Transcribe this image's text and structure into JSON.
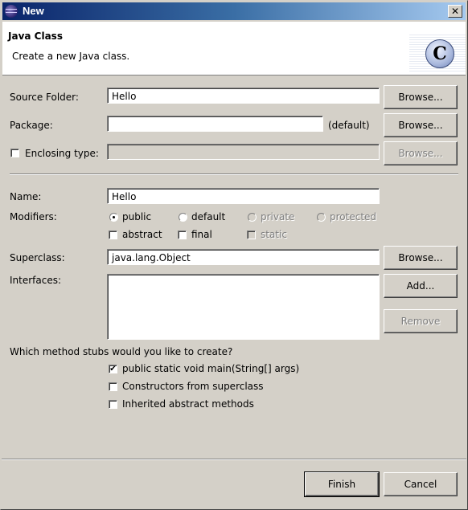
{
  "window": {
    "title": "New",
    "close_glyph": "✕"
  },
  "banner": {
    "title": "Java Class",
    "description": "Create a new Java class.",
    "icon_letter": "C"
  },
  "form": {
    "source_folder": {
      "label": "Source Folder:",
      "value": "Hello",
      "browse_label": "Browse..."
    },
    "package": {
      "label": "Package:",
      "value": "",
      "hint": "(default)",
      "browse_label": "Browse..."
    },
    "enclosing_type": {
      "label": "Enclosing type:",
      "checked": false,
      "value": "",
      "browse_label": "Browse..."
    },
    "name": {
      "label": "Name:",
      "value": "Hello"
    },
    "modifiers": {
      "label": "Modifiers:",
      "access": [
        {
          "label": "public",
          "selected": true,
          "enabled": true
        },
        {
          "label": "default",
          "selected": false,
          "enabled": true
        },
        {
          "label": "private",
          "selected": false,
          "enabled": false
        },
        {
          "label": "protected",
          "selected": false,
          "enabled": false
        }
      ],
      "flags": [
        {
          "label": "abstract",
          "checked": false,
          "enabled": true
        },
        {
          "label": "final",
          "checked": false,
          "enabled": true
        },
        {
          "label": "static",
          "checked": false,
          "enabled": false
        }
      ]
    },
    "superclass": {
      "label": "Superclass:",
      "value": "java.lang.Object",
      "browse_label": "Browse..."
    },
    "interfaces": {
      "label": "Interfaces:",
      "items": [],
      "add_label": "Add...",
      "remove_label": "Remove"
    },
    "stubs": {
      "question": "Which method stubs would you like to create?",
      "options": [
        {
          "label": "public static void main(String[] args)",
          "checked": true
        },
        {
          "label": "Constructors from superclass",
          "checked": false
        },
        {
          "label": "Inherited abstract methods",
          "checked": false
        }
      ]
    }
  },
  "footer": {
    "finish_label": "Finish",
    "cancel_label": "Cancel"
  },
  "check_glyph": "✔"
}
